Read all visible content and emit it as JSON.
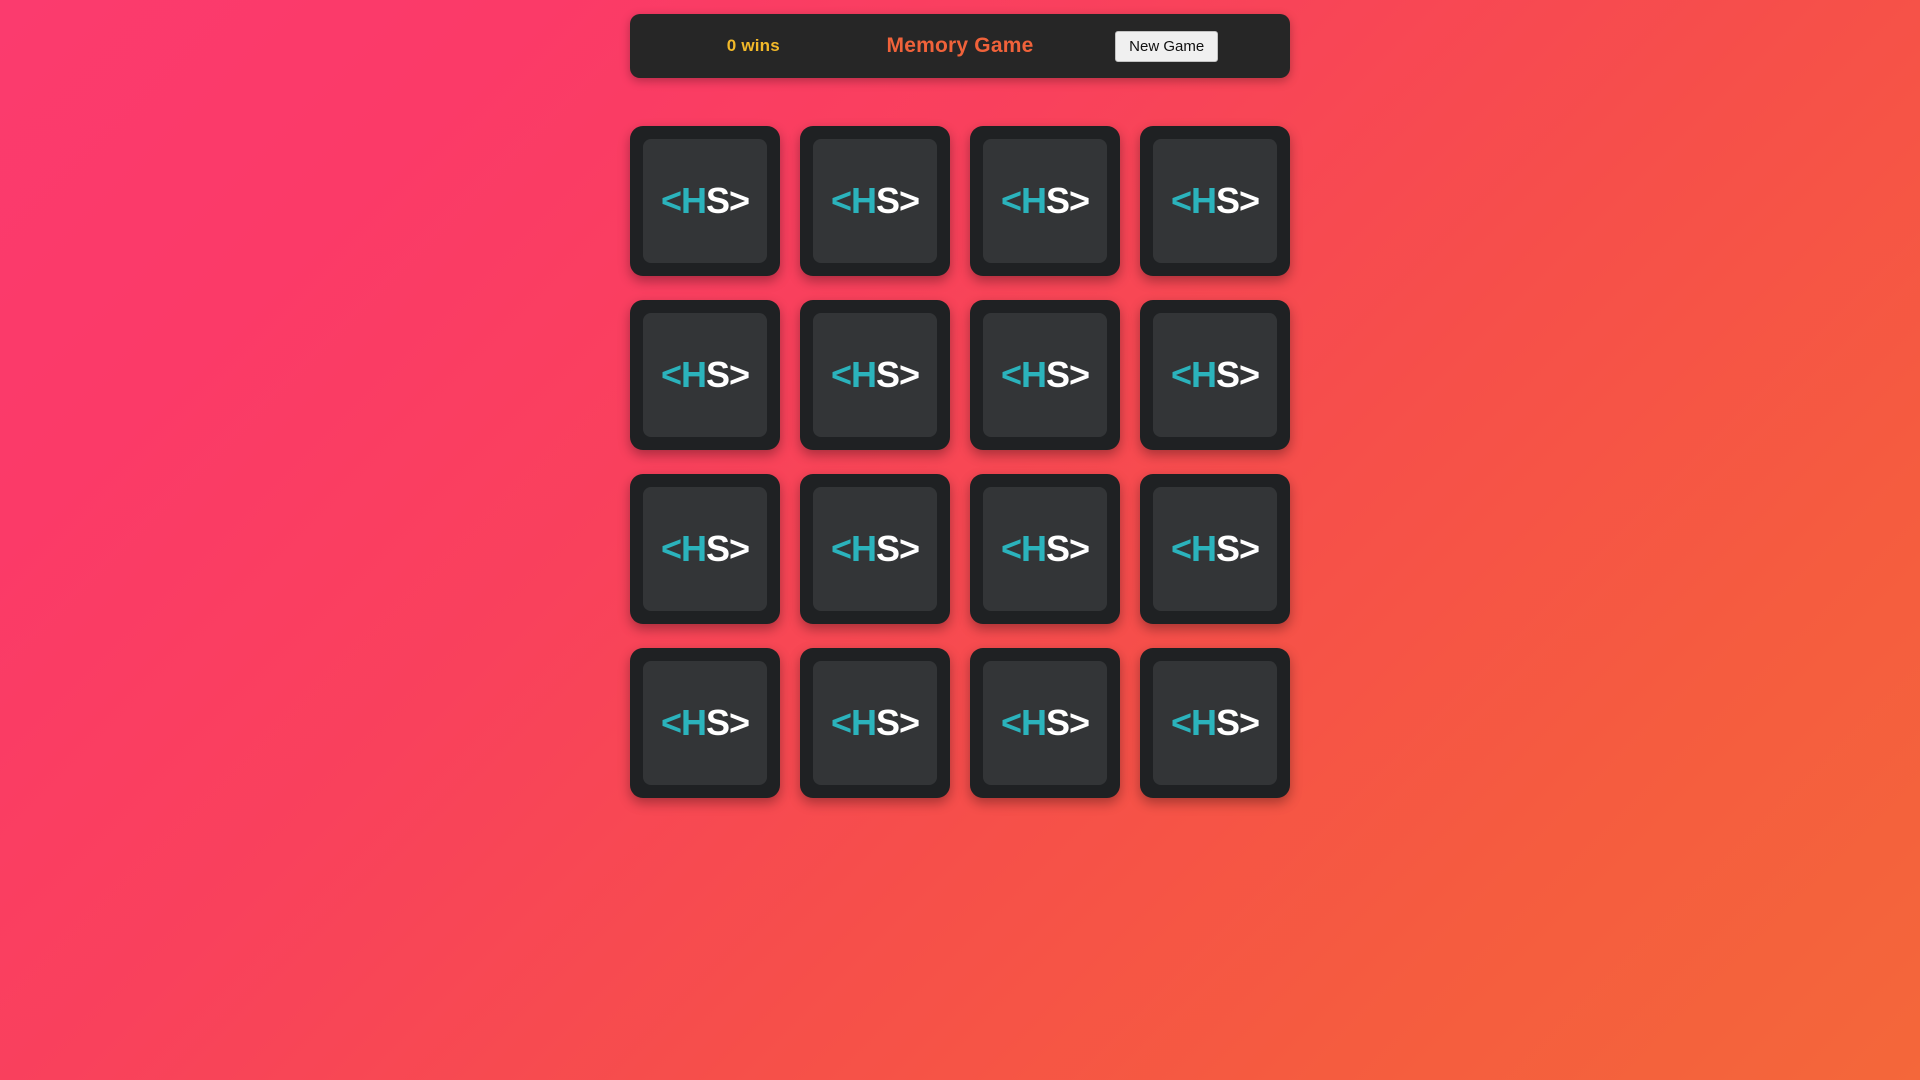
{
  "page": {
    "title": "Memory Game",
    "background_from": "#fb3b6e",
    "background_to": "#f4673a"
  },
  "header": {
    "wins_text": "0 wins",
    "wins_count": 0,
    "wins_color": "#f2b929",
    "title": "Memory Game",
    "title_color": "#f0623a",
    "bar_color": "#262626",
    "new_game_label": "New Game",
    "new_game_bg": "#f0f0f0"
  },
  "board": {
    "rows": 4,
    "columns": 4,
    "total_cards": 16,
    "card_back_color": "#1f2123",
    "card_face_color": "#333537",
    "logo": {
      "open": "<H",
      "close": "S>",
      "open_color": "#2bb3bc",
      "close_color": "#ffffff"
    },
    "cards": [
      {
        "index": 1,
        "state": "face-down"
      },
      {
        "index": 2,
        "state": "face-down"
      },
      {
        "index": 3,
        "state": "face-down"
      },
      {
        "index": 4,
        "state": "face-down"
      },
      {
        "index": 5,
        "state": "face-down"
      },
      {
        "index": 6,
        "state": "face-down"
      },
      {
        "index": 7,
        "state": "face-down"
      },
      {
        "index": 8,
        "state": "face-down"
      },
      {
        "index": 9,
        "state": "face-down"
      },
      {
        "index": 10,
        "state": "face-down"
      },
      {
        "index": 11,
        "state": "face-down"
      },
      {
        "index": 12,
        "state": "face-down"
      },
      {
        "index": 13,
        "state": "face-down"
      },
      {
        "index": 14,
        "state": "face-down"
      },
      {
        "index": 15,
        "state": "face-down"
      },
      {
        "index": 16,
        "state": "face-down"
      }
    ]
  }
}
